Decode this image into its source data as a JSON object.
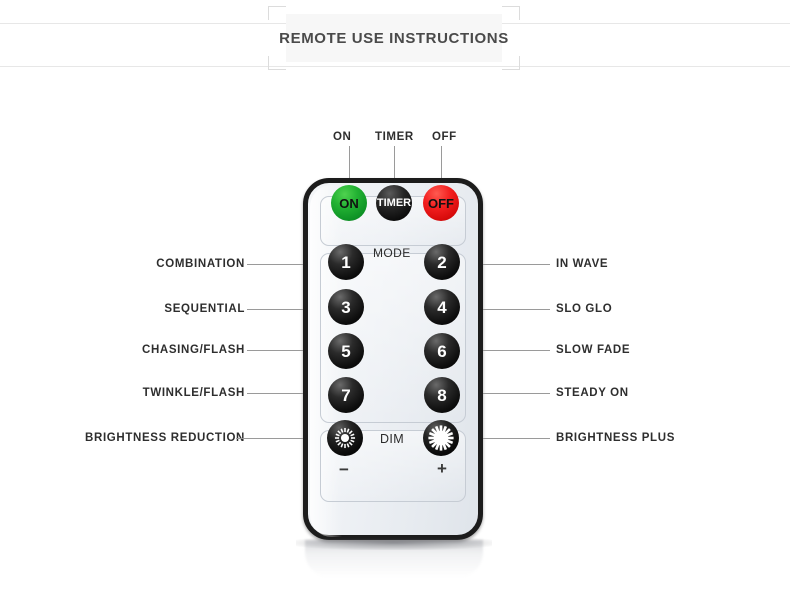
{
  "header": {
    "title": "REMOTE USE INSTRUCTIONS"
  },
  "remote": {
    "power_buttons": [
      {
        "id": "on",
        "label": "ON",
        "color": "#23b233"
      },
      {
        "id": "timer",
        "label": "TIMER",
        "color": "#141414"
      },
      {
        "id": "off",
        "label": "OFF",
        "color": "#f32020"
      }
    ],
    "mode_section_label": "MODE",
    "mode_buttons": [
      {
        "id": "1",
        "label": "1"
      },
      {
        "id": "2",
        "label": "2"
      },
      {
        "id": "3",
        "label": "3"
      },
      {
        "id": "4",
        "label": "4"
      },
      {
        "id": "5",
        "label": "5"
      },
      {
        "id": "6",
        "label": "6"
      },
      {
        "id": "7",
        "label": "7"
      },
      {
        "id": "8",
        "label": "8"
      }
    ],
    "dim_section_label": "DIM",
    "dim_minus_sign": "−",
    "dim_plus_sign": "+",
    "dim_buttons": [
      {
        "id": "dim-down",
        "icon": "sun-small-icon"
      },
      {
        "id": "dim-up",
        "icon": "sun-large-icon"
      }
    ]
  },
  "callouts": {
    "top": [
      {
        "id": "on",
        "label": "ON"
      },
      {
        "id": "timer",
        "label": "TIMER"
      },
      {
        "id": "off",
        "label": "OFF"
      }
    ],
    "left": [
      {
        "id": "combination",
        "label": "COMBINATION"
      },
      {
        "id": "sequential",
        "label": "SEQUENTIAL"
      },
      {
        "id": "chasing-flash",
        "label": "CHASING/FLASH"
      },
      {
        "id": "twinkle-flash",
        "label": "TWINKLE/FLASH"
      },
      {
        "id": "brightness-reduction",
        "label": "BRIGHTNESS REDUCTION"
      }
    ],
    "right": [
      {
        "id": "in-wave",
        "label": "IN WAVE"
      },
      {
        "id": "slo-glo",
        "label": "SLO GLO"
      },
      {
        "id": "slow-fade",
        "label": "SLOW FADE"
      },
      {
        "id": "steady-on",
        "label": "STEADY ON"
      },
      {
        "id": "brightness-plus",
        "label": "BRIGHTNESS PLUS"
      }
    ]
  },
  "colors": {
    "page_background": "#ffffff",
    "rule": "#e7e7e7",
    "title_text": "#4a4a4a",
    "label_text": "#2e2e2e",
    "leader_line": "#9a9a9a",
    "remote_border": "#1c1c1c",
    "remote_body": "#eef1f5"
  }
}
